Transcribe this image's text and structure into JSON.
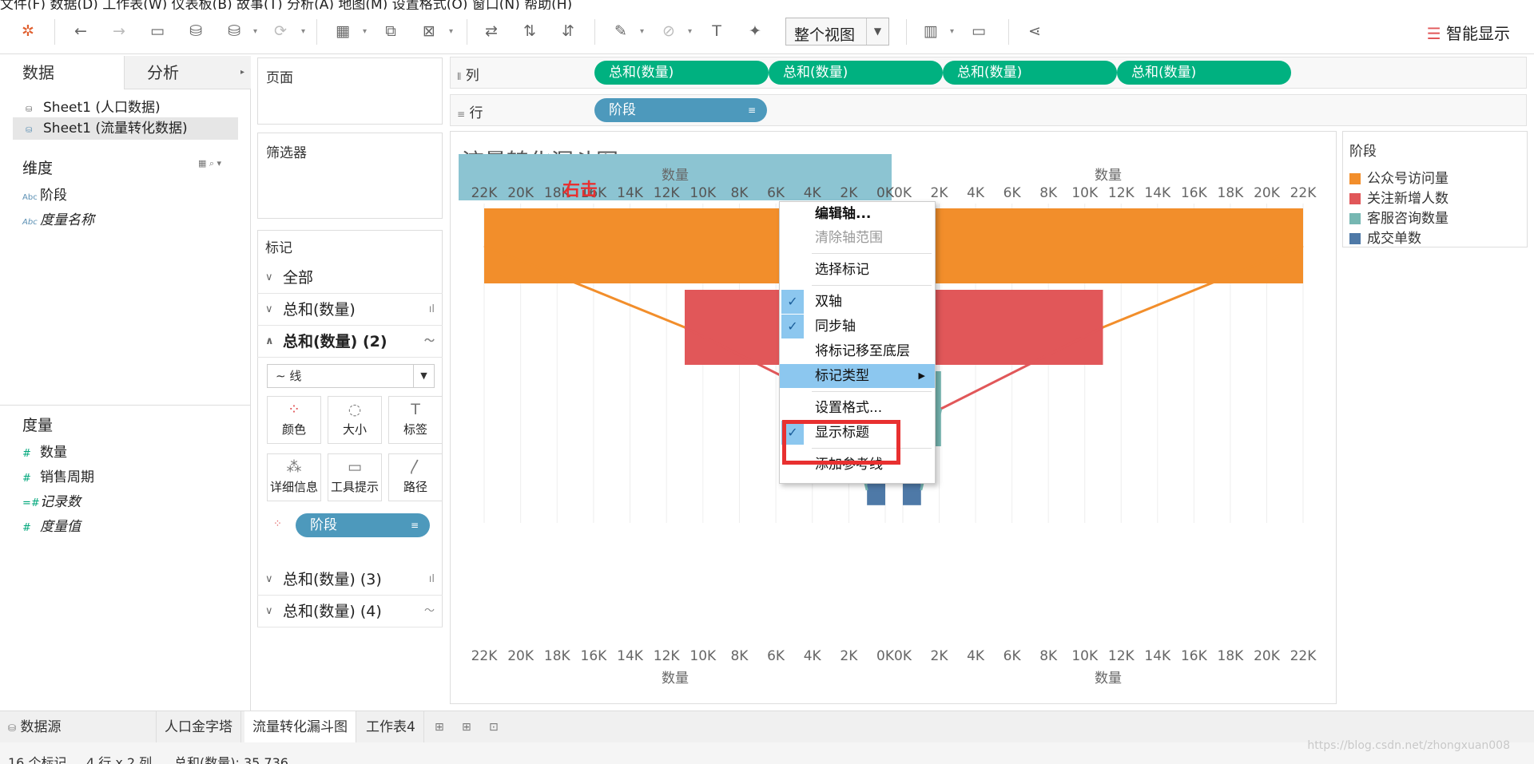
{
  "menubar": {
    "text": "文件(F)  数据(D)  工作表(W)  仪表板(B)  故事(T)  分析(A)  地图(M)  设置格式(O)  窗口(N)  帮助(H)"
  },
  "toolbar": {
    "view_select": "整个视图",
    "show_me": "智能显示"
  },
  "left_panel": {
    "tab_data": "数据",
    "tab_analysis": "分析",
    "sources": [
      "Sheet1 (人口数据)",
      "Sheet1 (流量转化数据)"
    ],
    "dimensions_title": "维度",
    "dimensions": [
      "阶段",
      "度量名称"
    ],
    "measures_title": "度量",
    "measures": [
      "数量",
      "销售周期",
      "记录数",
      "度量值"
    ]
  },
  "pages": {
    "title": "页面"
  },
  "filters": {
    "title": "筛选器"
  },
  "marks": {
    "title": "标记",
    "cards": [
      "全部",
      "总和(数量)",
      "总和(数量) (2)",
      "总和(数量) (3)",
      "总和(数量) (4)"
    ],
    "mark_type": "线",
    "buttons": [
      "颜色",
      "大小",
      "标签",
      "详细信息",
      "工具提示",
      "路径"
    ],
    "pill": "阶段"
  },
  "shelves": {
    "columns_label": "列",
    "rows_label": "行",
    "columns": [
      "总和(数量)",
      "总和(数量)",
      "总和(数量)",
      "总和(数量)"
    ],
    "rows": [
      "阶段"
    ]
  },
  "viz": {
    "title": "流量转化漏斗图",
    "annotation": "右击",
    "axis_title": "数量",
    "left_ticks": [
      "22K",
      "20K",
      "18K",
      "16K",
      "14K",
      "12K",
      "10K",
      "8K",
      "6K",
      "4K",
      "2K",
      "0K"
    ],
    "right_ticks": [
      "0K",
      "2K",
      "4K",
      "6K",
      "8K",
      "10K",
      "12K",
      "14K",
      "16K",
      "18K",
      "20K",
      "22K"
    ]
  },
  "chart_data": {
    "type": "bar",
    "title": "流量转化漏斗图",
    "categories": [
      "公众号访问量",
      "关注新增人数",
      "客服咨询数量",
      "成交单数"
    ],
    "values": [
      22000,
      11000,
      2100,
      1000
    ],
    "xlabel": "数量",
    "xlim": [
      0,
      22000
    ],
    "colors": [
      "#f28e2b",
      "#e15759",
      "#76b7b2",
      "#4e79a7"
    ]
  },
  "legend": {
    "title": "阶段",
    "items": [
      "公众号访问量",
      "关注新增人数",
      "客服咨询数量",
      "成交单数"
    ]
  },
  "context_menu": {
    "items": [
      "编辑轴...",
      "清除轴范围",
      "选择标记",
      "双轴",
      "同步轴",
      "将标记移至底层",
      "标记类型",
      "设置格式...",
      "显示标题",
      "添加参考线"
    ]
  },
  "bottom_tabs": [
    "数据源",
    "人口金字塔",
    "流量转化漏斗图",
    "工作表4"
  ],
  "status": {
    "marks": "16 个标记",
    "rows_cols": "4 行 x 2 列",
    "sum": "总和(数量): 35,736",
    "watermark": "https://blog.csdn.net/zhongxuan008"
  }
}
